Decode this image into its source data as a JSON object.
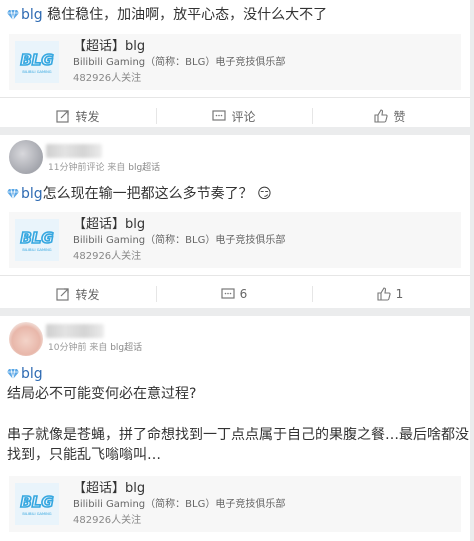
{
  "brand": {
    "accent": "#2f6bb3",
    "link": "#2f6bb3",
    "bg": "#ebeced"
  },
  "topic": {
    "title": "【超话】blg",
    "subtitle": "Bilibili Gaming（简称：BLG）电子竞技俱乐部",
    "followers": "482926人关注",
    "logo_text": "BLG",
    "logo_sub": "BILIBILI GAMING"
  },
  "post1": {
    "tag": "blg",
    "text": " 稳住稳住，加油啊，放平心态，没什么大不了",
    "actions": {
      "repost": "转发",
      "comment": "评论",
      "like": "赞"
    }
  },
  "post2": {
    "meta_time": "11分钟前",
    "meta_action": "评论",
    "meta_from": "来自",
    "meta_source": "blg超话",
    "tag": "blg",
    "text": "怎么现在输一把都这么多节奏了？",
    "emoji": "😏",
    "actions": {
      "repost": "转发",
      "comment": "6",
      "like": "1"
    }
  },
  "post3": {
    "meta_time": "10分钟前",
    "meta_from": "来自",
    "meta_source": "blg超话",
    "tag": "blg",
    "line1": "结局必不可能变何必在意过程?",
    "line2": "串子就像是苍蝇，拼了命想找到一丁点点属于自己的果腹之餐…最后啥都没",
    "line3": "找到，只能乱飞嗡嗡叫…"
  }
}
